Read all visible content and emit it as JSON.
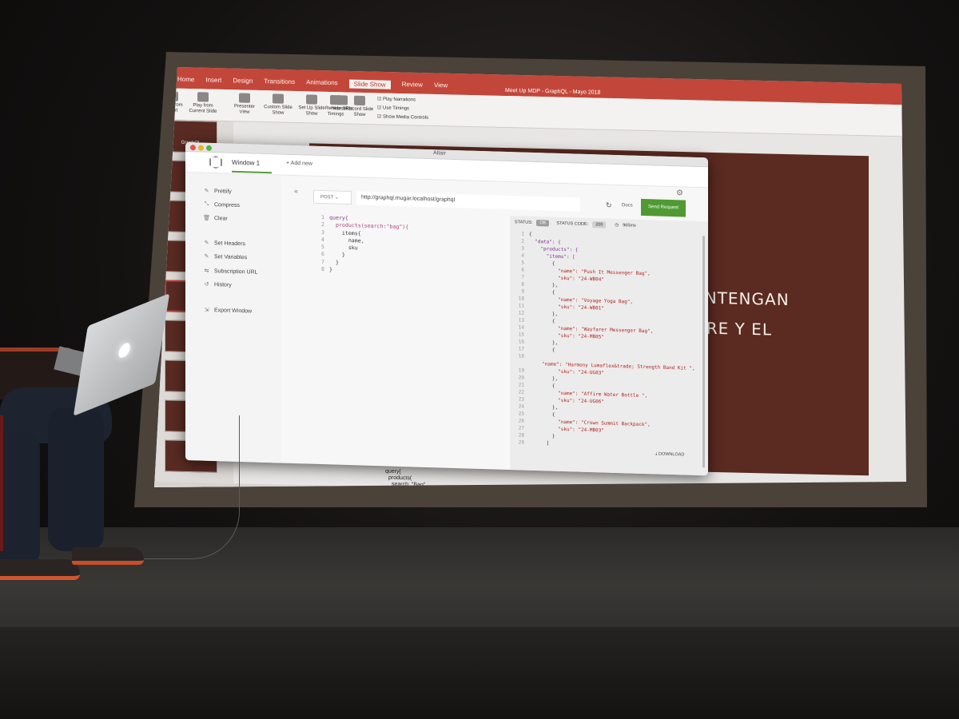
{
  "ppt": {
    "ribbon_tabs": [
      "Home",
      "Insert",
      "Design",
      "Transitions",
      "Animations",
      "Slide Show",
      "Review",
      "View"
    ],
    "active_tab": "Slide Show",
    "document_title": "Meet Up MDP - GraphQL - Mayo 2018",
    "ribbon_buttons": [
      "Play from Start",
      "Play from Current Slide",
      "Presenter View",
      "Custom Slide Show",
      "Set Up Slide Show",
      "Hide Slide",
      "Rehearse Timings",
      "Record Slide Show"
    ],
    "ribbon_checks": [
      "Play Narrations",
      "Use Timings",
      "Show Media Controls"
    ],
    "thumb_label": "GraphQL",
    "slide_lines": [
      "ONTENGAN",
      "BRE Y EL"
    ],
    "notes": [
      "query{",
      "products(",
      "search: \"Bag\""
    ]
  },
  "altair": {
    "app_title": "Altair",
    "tabs": [
      "Window 1",
      "+ Add new"
    ],
    "sidebar": [
      "Prettify",
      "Compress",
      "Clear",
      "Set Headers",
      "Set Variables",
      "Subscription URL",
      "History",
      "Export Window"
    ],
    "sidebar_icons": [
      "wand-icon",
      "compress-icon",
      "trash-icon",
      "headers-icon",
      "variables-icon",
      "subscription-icon",
      "history-icon",
      "export-icon"
    ],
    "method": "POST",
    "url": "http://graphql.mugar.localhost/graphql",
    "docs_label": "Docs",
    "send_label": "Send Request",
    "query_lines": [
      "query{",
      "  products(search:\"bag\"){",
      "    items{",
      "      name,",
      "      sku",
      "    }",
      "  }",
      "}"
    ],
    "status_label": "STATUS:",
    "status_value": "OK",
    "status_code_label": "STATUS CODE:",
    "status_code": "200",
    "time": "965ms",
    "download_label": "DOWNLOAD",
    "response_lines": [
      "{",
      "  \"data\": {",
      "    \"products\": {",
      "      \"items\": [",
      "        {",
      "          \"name\": \"Push It Messenger Bag\",",
      "          \"sku\": \"24-WB04\"",
      "        },",
      "        {",
      "          \"name\": \"Voyage Yoga Bag\",",
      "          \"sku\": \"24-WB01\"",
      "        },",
      "        {",
      "          \"name\": \"Wayfarer Messenger Bag\",",
      "          \"sku\": \"24-MB05\"",
      "        },",
      "        {",
      "          \"name\": \"Harmony Lumaflex&trade; Strength Band Kit \",",
      "          \"sku\": \"24-UG03\"",
      "        },",
      "        {",
      "          \"name\": \"Affirm Water Bottle \",",
      "          \"sku\": \"24-UG06\"",
      "        },",
      "        {",
      "          \"name\": \"Crown Summit Backpack\",",
      "          \"sku\": \"24-MB03\"",
      "        }",
      "      ]"
    ]
  }
}
